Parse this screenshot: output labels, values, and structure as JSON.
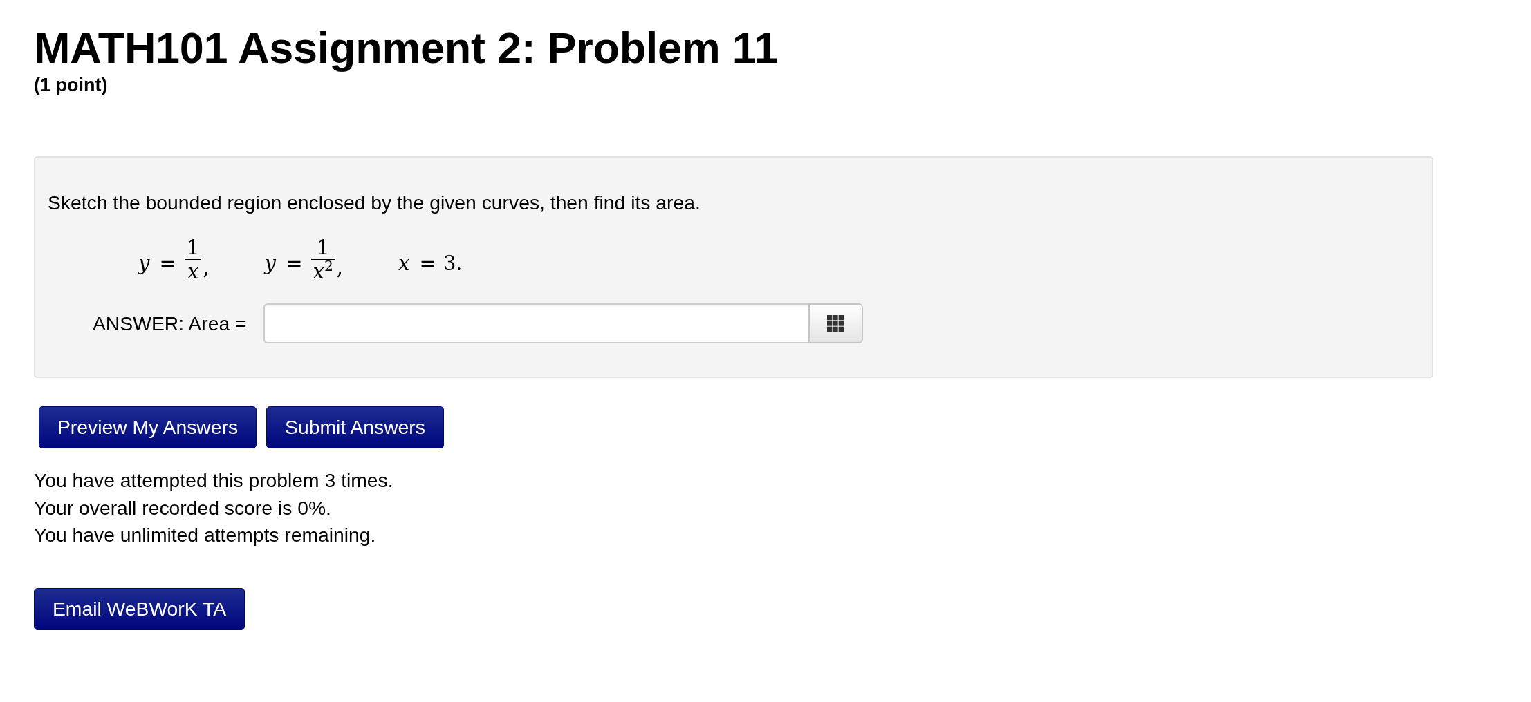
{
  "title": "MATH101 Assignment 2: Problem 11",
  "points": "(1 point)",
  "problem": {
    "prompt": "Sketch the bounded region enclosed by the given curves, then find its area.",
    "equations": [
      {
        "kind": "fraction",
        "lhs": "*y* =",
        "numerator": "1",
        "denominator": "x",
        "punctuation": ","
      },
      {
        "kind": "fraction",
        "lhs": "*y* =",
        "numerator": "1",
        "denominator": "x$^{2}$",
        "punctuation": ","
      },
      {
        "kind": "value",
        "lhs": "*x* =",
        "value": "3."
      }
    ],
    "answer": {
      "label": "ANSWER: Area ="
    }
  },
  "buttons": [
    {
      "label": "Preview My Answers"
    },
    {
      "label": "Submit Answers"
    }
  ],
  "status_messages": [
    "You have attempted this problem 3 times.",
    "Your overall recorded score is 0%.",
    "You have unlimited attempts remaining."
  ],
  "email_button": {
    "label": "Email WeBWorK TA"
  }
}
